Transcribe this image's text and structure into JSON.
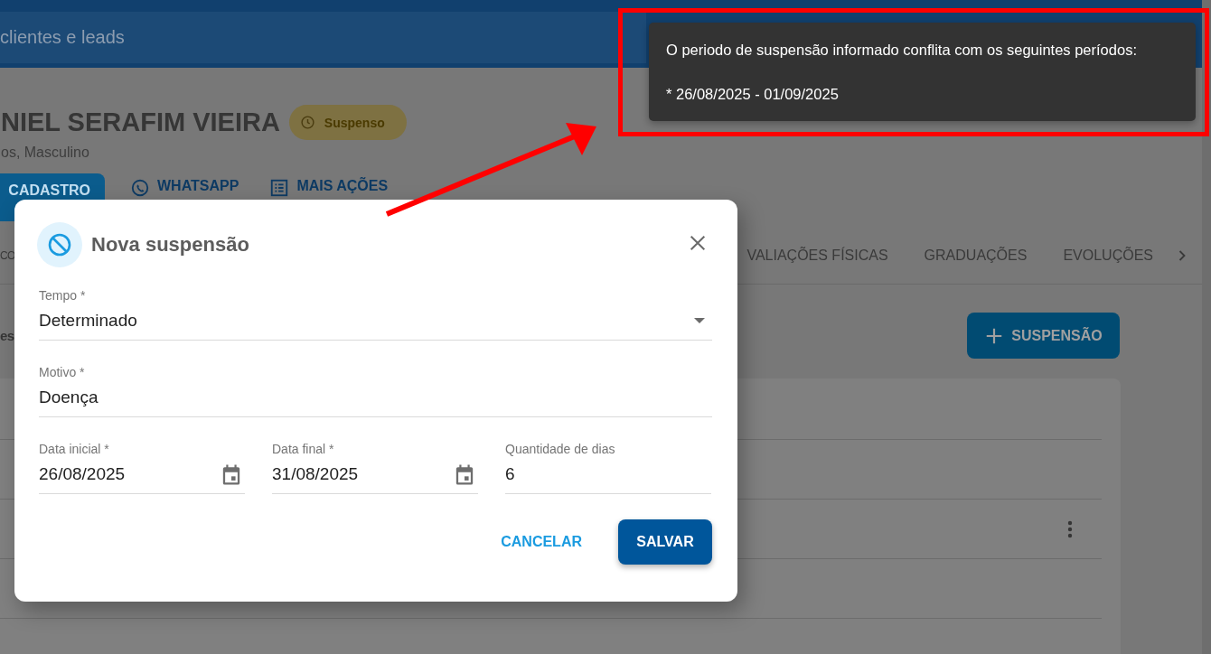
{
  "top_bar": {
    "search": {
      "placeholder": "clientes e leads"
    }
  },
  "client": {
    "name": "NIEL SERAFIM VIEIRA",
    "status": "Suspenso",
    "details": "os, Masculino"
  },
  "actions": [
    {
      "label": "CADASTRO",
      "selected": true
    },
    {
      "label": "WHATSAPP",
      "selected": false
    },
    {
      "label": "MAIS AÇÕES",
      "selected": false
    }
  ],
  "tabs": [
    "CO",
    "VALIAÇÕES FÍSICAS",
    "GRADUAÇÕES",
    "EVOLUÇÕES"
  ],
  "section": {
    "title": "es",
    "add_button": "SUSPENSÃO"
  },
  "list_rows": [
    {
      "menu": false
    },
    {
      "menu": false
    },
    {
      "menu": true
    },
    {
      "menu": false
    }
  ],
  "dialog": {
    "title": "Nova suspensão",
    "fields": [
      {
        "kind": "select",
        "label": "Tempo *",
        "value": "Determinado"
      },
      {
        "kind": "text",
        "label": "Motivo *",
        "value": "Doença"
      },
      {
        "kind": "date",
        "label": "Data inicial *",
        "value": "26/08/2025"
      },
      {
        "kind": "date",
        "label": "Data final *",
        "value": "31/08/2025"
      },
      {
        "kind": "text",
        "label": "Quantidade de dias",
        "value": "6"
      }
    ],
    "buttons": [
      {
        "kind": "text",
        "label": "CANCELAR"
      },
      {
        "kind": "primary",
        "label": "SALVAR"
      }
    ]
  },
  "snackbar": {
    "lines": [
      "O periodo de suspensão informado conflita com os seguintes períodos:",
      "* 26/08/2025 - 01/09/2025"
    ]
  },
  "annotation": {
    "highlight_box": true,
    "arrow": true
  }
}
